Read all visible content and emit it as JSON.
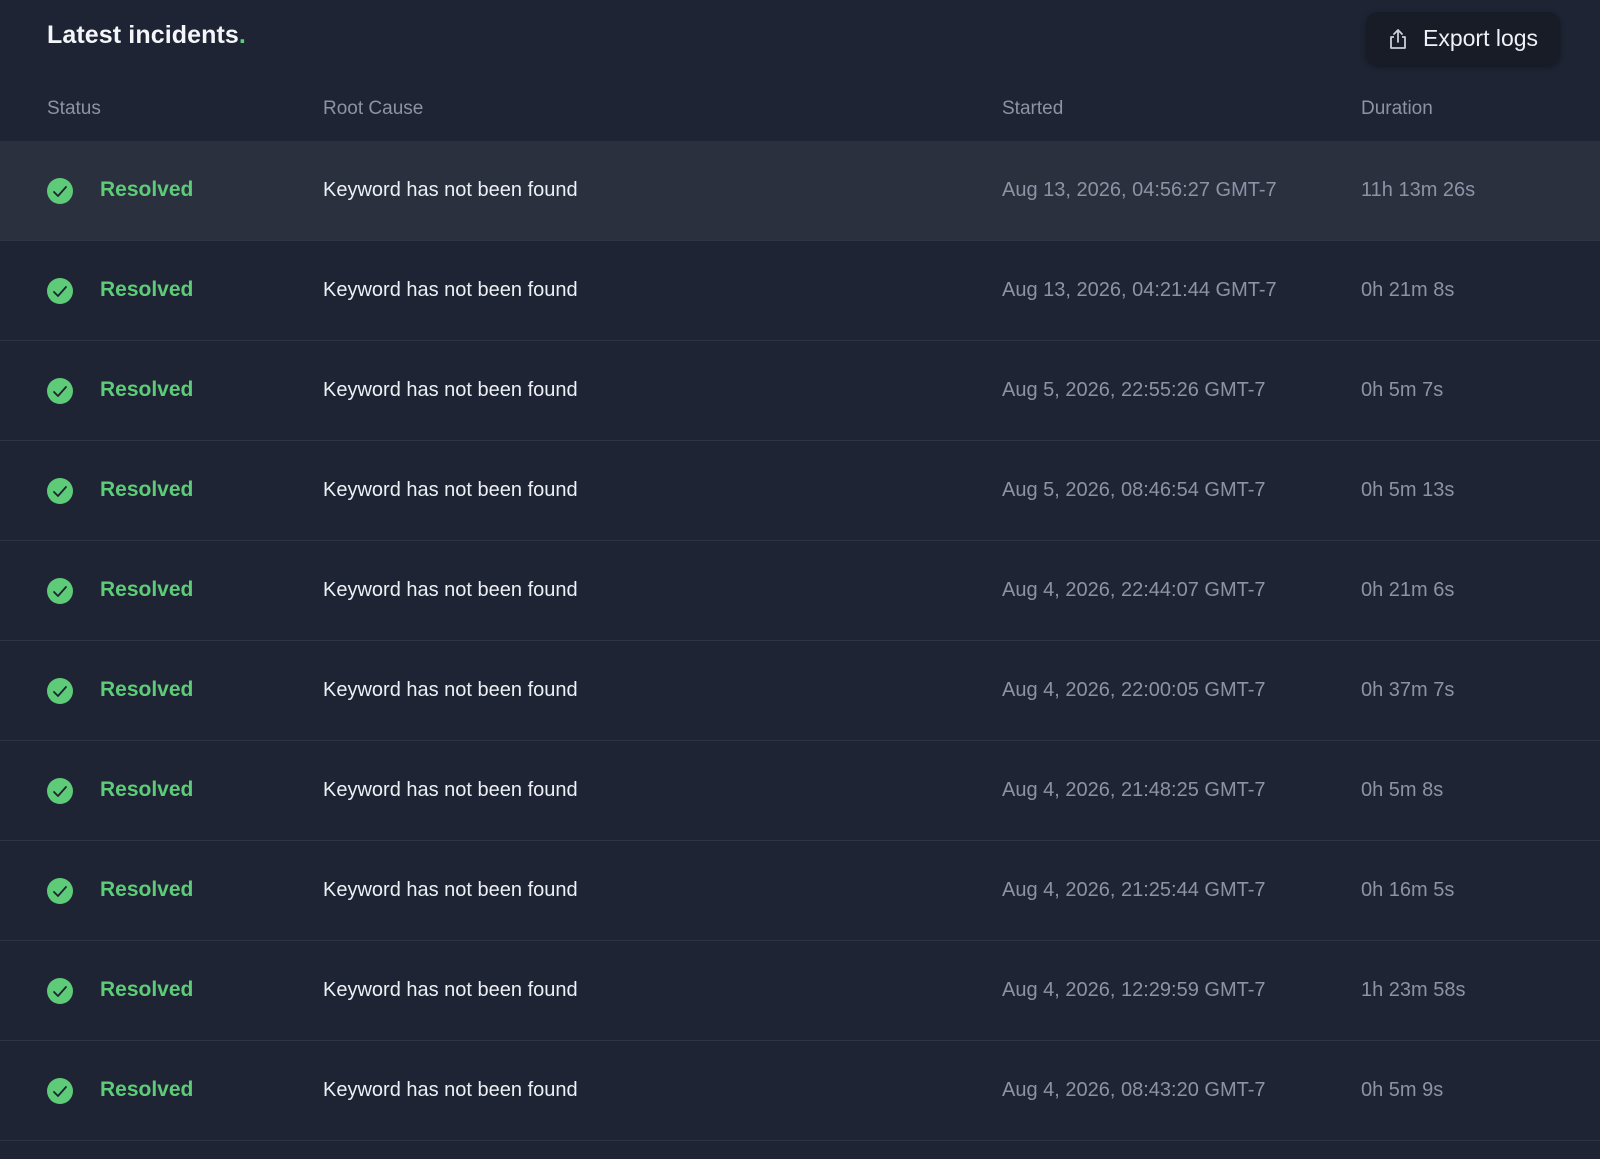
{
  "header": {
    "title": "Latest incidents",
    "title_dot": ".",
    "export_label": "Export logs",
    "export_icon": "share-upload-icon"
  },
  "columns": {
    "status": "Status",
    "root_cause": "Root Cause",
    "started": "Started",
    "duration": "Duration"
  },
  "colors": {
    "background": "#1e2433",
    "resolved_green": "#5ecb78",
    "muted_text": "#8b93a5",
    "highlight_row": "#2a303e"
  },
  "incidents": [
    {
      "status": "Resolved",
      "root_cause": "Keyword has not been found",
      "started": "Aug 13, 2026, 04:56:27 GMT-7",
      "duration": "11h 13m 26s",
      "icon": "check-circle-icon"
    },
    {
      "status": "Resolved",
      "root_cause": "Keyword has not been found",
      "started": "Aug 13, 2026, 04:21:44 GMT-7",
      "duration": "0h 21m 8s",
      "icon": "check-circle-icon"
    },
    {
      "status": "Resolved",
      "root_cause": "Keyword has not been found",
      "started": "Aug 5, 2026, 22:55:26 GMT-7",
      "duration": "0h 5m 7s",
      "icon": "check-circle-icon"
    },
    {
      "status": "Resolved",
      "root_cause": "Keyword has not been found",
      "started": "Aug 5, 2026, 08:46:54 GMT-7",
      "duration": "0h 5m 13s",
      "icon": "check-circle-icon"
    },
    {
      "status": "Resolved",
      "root_cause": "Keyword has not been found",
      "started": "Aug 4, 2026, 22:44:07 GMT-7",
      "duration": "0h 21m 6s",
      "icon": "check-circle-icon"
    },
    {
      "status": "Resolved",
      "root_cause": "Keyword has not been found",
      "started": "Aug 4, 2026, 22:00:05 GMT-7",
      "duration": "0h 37m 7s",
      "icon": "check-circle-icon"
    },
    {
      "status": "Resolved",
      "root_cause": "Keyword has not been found",
      "started": "Aug 4, 2026, 21:48:25 GMT-7",
      "duration": "0h 5m 8s",
      "icon": "check-circle-icon"
    },
    {
      "status": "Resolved",
      "root_cause": "Keyword has not been found",
      "started": "Aug 4, 2026, 21:25:44 GMT-7",
      "duration": "0h 16m 5s",
      "icon": "check-circle-icon"
    },
    {
      "status": "Resolved",
      "root_cause": "Keyword has not been found",
      "started": "Aug 4, 2026, 12:29:59 GMT-7",
      "duration": "1h 23m 58s",
      "icon": "check-circle-icon"
    },
    {
      "status": "Resolved",
      "root_cause": "Keyword has not been found",
      "started": "Aug 4, 2026, 08:43:20 GMT-7",
      "duration": "0h 5m 9s",
      "icon": "check-circle-icon"
    }
  ]
}
